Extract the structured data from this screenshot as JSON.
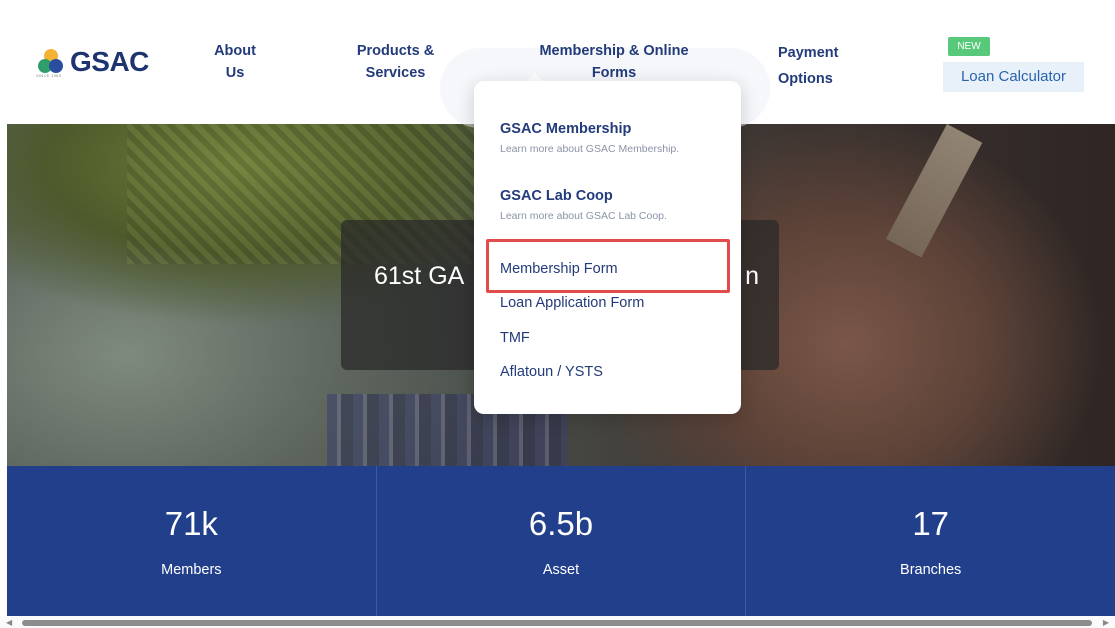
{
  "brand": {
    "name": "GSAC",
    "tagline": "SINCE 1969"
  },
  "nav": {
    "about": [
      "About",
      "Us"
    ],
    "products": [
      "Products &",
      "Services"
    ],
    "membership": [
      "Membership & Online",
      "Forms"
    ],
    "payment": [
      "Payment",
      "Options"
    ],
    "new_badge": "NEW",
    "loan_calculator": "Loan Calculator"
  },
  "dropdown": {
    "sections": [
      {
        "title": "GSAC Membership",
        "subtitle": "Learn more about GSAC Membership."
      },
      {
        "title": "GSAC Lab Coop",
        "subtitle": "Learn more about GSAC Lab Coop."
      }
    ],
    "links": [
      "Membership Form",
      "Loan Application Form",
      "TMF",
      "Aflatoun / YSTS"
    ]
  },
  "hero": {
    "title_visible": "61st GA",
    "title_tail": "n"
  },
  "stats": [
    {
      "value": "71k",
      "label": "Members"
    },
    {
      "value": "6.5b",
      "label": "Asset"
    },
    {
      "value": "17",
      "label": "Branches"
    }
  ],
  "colors": {
    "navy": "#233b7a",
    "stats_bg": "#223f8c",
    "badge_green": "#58c97a",
    "calc_bg": "#e8f1fa",
    "highlight_red": "#e24b4b"
  }
}
